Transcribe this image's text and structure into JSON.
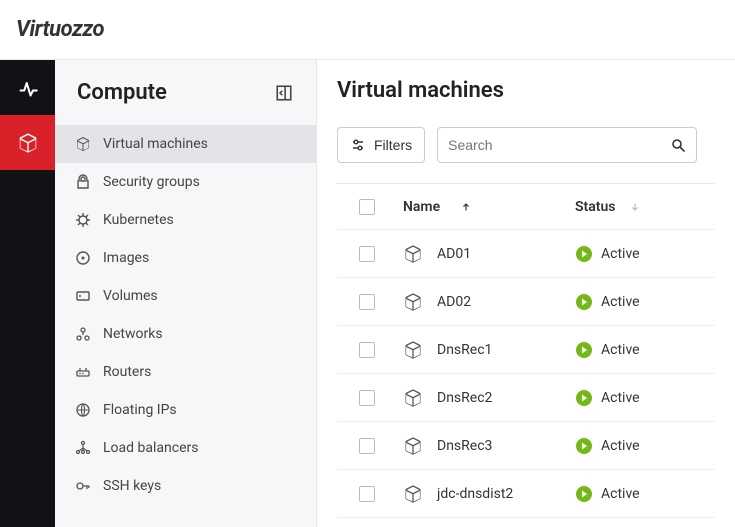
{
  "brand": "Virtuozzo",
  "sidebar": {
    "title": "Compute",
    "items": [
      {
        "label": "Virtual machines",
        "selected": true,
        "icon": "cube"
      },
      {
        "label": "Security groups",
        "selected": false,
        "icon": "lock"
      },
      {
        "label": "Kubernetes",
        "selected": false,
        "icon": "helm"
      },
      {
        "label": "Images",
        "selected": false,
        "icon": "disc"
      },
      {
        "label": "Volumes",
        "selected": false,
        "icon": "hdd"
      },
      {
        "label": "Networks",
        "selected": false,
        "icon": "net"
      },
      {
        "label": "Routers",
        "selected": false,
        "icon": "router"
      },
      {
        "label": "Floating IPs",
        "selected": false,
        "icon": "globe"
      },
      {
        "label": "Load balancers",
        "selected": false,
        "icon": "lb"
      },
      {
        "label": "SSH keys",
        "selected": false,
        "icon": "key"
      }
    ]
  },
  "page": {
    "title": "Virtual machines"
  },
  "toolbar": {
    "filters_label": "Filters",
    "search_placeholder": "Search"
  },
  "table": {
    "cols": {
      "name": "Name",
      "status": "Status"
    },
    "rows": [
      {
        "name": "AD01",
        "status": "Active"
      },
      {
        "name": "AD02",
        "status": "Active"
      },
      {
        "name": "DnsRec1",
        "status": "Active"
      },
      {
        "name": "DnsRec2",
        "status": "Active"
      },
      {
        "name": "DnsRec3",
        "status": "Active"
      },
      {
        "name": "jdc-dnsdist2",
        "status": "Active"
      }
    ]
  },
  "colors": {
    "accent": "#d9212a",
    "active": "#74b816"
  }
}
